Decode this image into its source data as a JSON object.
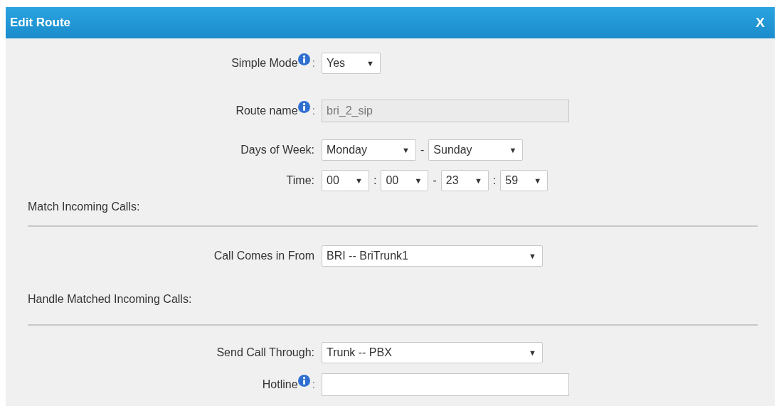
{
  "window": {
    "title": "Edit Route",
    "close": "X"
  },
  "rows": [
    {
      "kind": "field",
      "label": "Simple Mode",
      "info": true,
      "suffix": ":",
      "controls": [
        {
          "kind": "select-small",
          "value": "Yes",
          "caret": "▼"
        }
      ]
    },
    {
      "kind": "field",
      "label": "Route name",
      "info": true,
      "suffix": ":",
      "controls": [
        {
          "kind": "textbox",
          "value": "bri_2_sip",
          "disabled": true
        }
      ]
    },
    {
      "kind": "field",
      "label": "Days of Week:",
      "info": false,
      "controls": [
        {
          "kind": "select-day",
          "value": "Monday",
          "caret": "▼"
        },
        {
          "kind": "separator",
          "text": "-"
        },
        {
          "kind": "select-day",
          "value": "Sunday",
          "caret": "▼"
        }
      ]
    },
    {
      "kind": "field",
      "label": "Time:",
      "info": false,
      "controls": [
        {
          "kind": "select-time",
          "value": "00",
          "caret": "▼"
        },
        {
          "kind": "separator",
          "text": ":"
        },
        {
          "kind": "select-time",
          "value": "00",
          "caret": "▼"
        },
        {
          "kind": "separator",
          "text": "-"
        },
        {
          "kind": "select-time",
          "value": "23",
          "caret": "▼"
        },
        {
          "kind": "separator",
          "text": ":"
        },
        {
          "kind": "select-time",
          "value": "59",
          "caret": "▼"
        }
      ]
    },
    {
      "kind": "section",
      "label": "Match Incoming Calls:"
    },
    {
      "kind": "field",
      "label": "Call Comes in From",
      "info": false,
      "controls": [
        {
          "kind": "select-wide",
          "value": "BRI -- BriTrunk1",
          "caret": "▼"
        }
      ]
    },
    {
      "kind": "section",
      "label": "Handle Matched Incoming Calls:"
    },
    {
      "kind": "field",
      "label": "Send Call Through:",
      "info": false,
      "controls": [
        {
          "kind": "select-wide",
          "value": "Trunk -- PBX",
          "caret": "▼"
        }
      ]
    },
    {
      "kind": "field",
      "label": "Hotline",
      "info": true,
      "suffix": ":",
      "controls": [
        {
          "kind": "textbox",
          "disabled": false
        }
      ]
    }
  ]
}
